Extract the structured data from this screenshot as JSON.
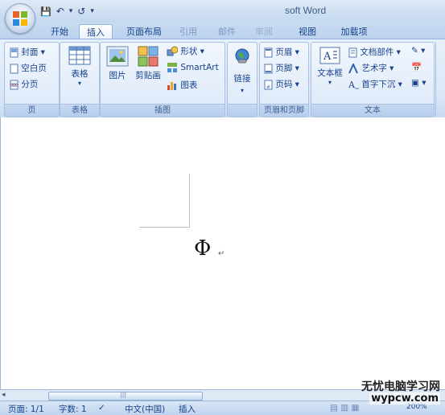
{
  "window": {
    "title": "soft Word"
  },
  "qat": {
    "save": "💾",
    "undo": "↶",
    "redo": "↺",
    "more": "▾"
  },
  "tabs": [
    "开始",
    "插入",
    "页面布局",
    "引用",
    "邮件",
    "审阅",
    "视图",
    "加载项"
  ],
  "active_tab": "插入",
  "ribbon": {
    "pages": {
      "label": "页",
      "items": [
        "封面",
        "空白页",
        "分页"
      ]
    },
    "table": {
      "label": "表格",
      "button": "表格"
    },
    "illustrations": {
      "label": "插图",
      "picture": "图片",
      "clipart": "剪贴画",
      "shapes": "形状",
      "smartart": "SmartArt",
      "chart": "图表"
    },
    "links": {
      "label": "",
      "button": "链接"
    },
    "header_footer": {
      "label": "页眉和页脚",
      "items": [
        "页眉",
        "页脚",
        "页码"
      ]
    },
    "text": {
      "label": "文本",
      "textbox": "文本框",
      "items": [
        "文档部件",
        "艺术字",
        "首字下沉"
      ]
    }
  },
  "document": {
    "symbol": "Φ",
    "para_mark": "↵"
  },
  "statusbar": {
    "page": "页面: 1/1",
    "words": "字数: 1",
    "language": "中文(中国)",
    "mode": "插入",
    "zoom": "200%"
  },
  "watermark": {
    "line1": "无忧电脑学习网",
    "line2": "wypcw.com"
  }
}
